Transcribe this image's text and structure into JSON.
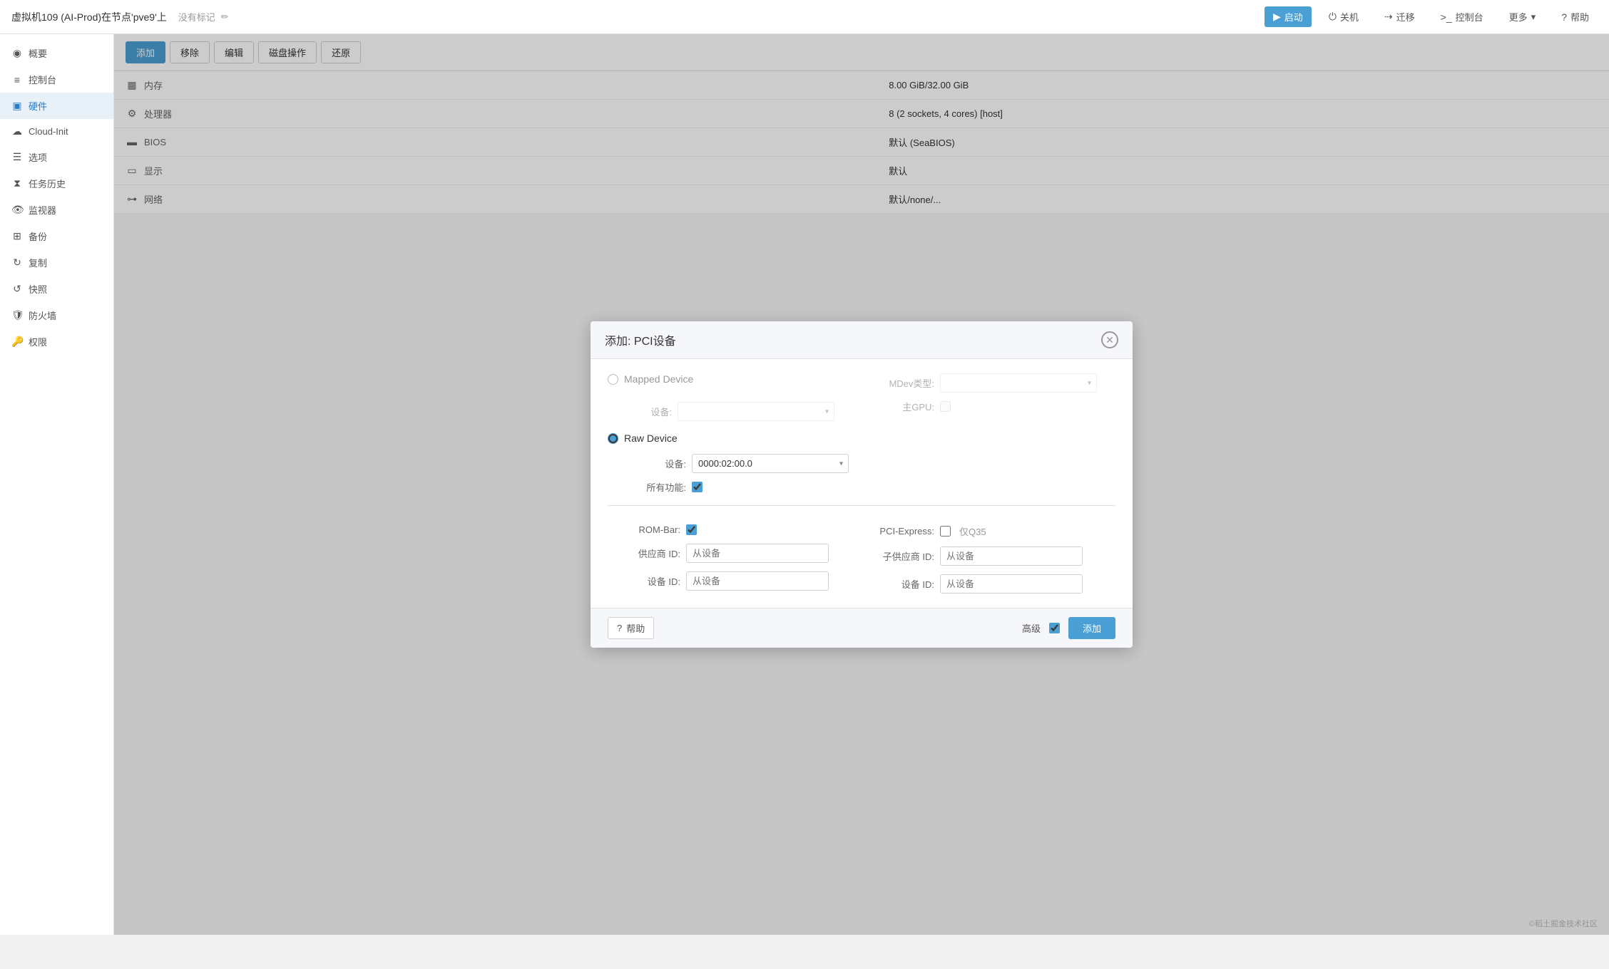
{
  "topbar": {
    "vm_title": "虚拟机109 (AI-Prod)在节点'pve9'上",
    "tag_placeholder": "没有标记",
    "btn_start": "启动",
    "btn_shutdown": "关机",
    "btn_migrate": "迁移",
    "btn_console": "控制台",
    "btn_more": "更多",
    "btn_help": "帮助"
  },
  "sidebar": {
    "items": [
      {
        "id": "summary",
        "label": "概要",
        "icon": "◉"
      },
      {
        "id": "console",
        "label": "控制台",
        "icon": "≡"
      },
      {
        "id": "hardware",
        "label": "硬件",
        "icon": "▣",
        "active": true
      },
      {
        "id": "cloudinit",
        "label": "Cloud-Init",
        "icon": "☁"
      },
      {
        "id": "options",
        "label": "选项",
        "icon": "☰"
      },
      {
        "id": "taskhistory",
        "label": "任务历史",
        "icon": "⧗"
      },
      {
        "id": "monitor",
        "label": "监视器",
        "icon": "👁"
      },
      {
        "id": "backup",
        "label": "备份",
        "icon": "⊞"
      },
      {
        "id": "replication",
        "label": "复制",
        "icon": "↻"
      },
      {
        "id": "snapshot",
        "label": "快照",
        "icon": "↺"
      },
      {
        "id": "firewall",
        "label": "防火墙",
        "icon": "🛡"
      },
      {
        "id": "permissions",
        "label": "权限",
        "icon": "🔑"
      }
    ]
  },
  "toolbar": {
    "btn_add": "添加",
    "btn_remove": "移除",
    "btn_edit": "编辑",
    "btn_disk_ops": "磁盘操作",
    "btn_restore": "还原"
  },
  "hardware_table": {
    "rows": [
      {
        "icon": "mem",
        "label": "内存",
        "value": "8.00 GiB/32.00 GiB"
      },
      {
        "icon": "cpu",
        "label": "处理器",
        "value": "8 (2 sockets, 4 cores) [host]"
      },
      {
        "icon": "bios",
        "label": "BIOS",
        "value": "默认 (SeaBIOS)"
      },
      {
        "icon": "display",
        "label": "显示",
        "value": "默认"
      },
      {
        "icon": "net",
        "label": "网络",
        "value": "默认/none/..."
      }
    ]
  },
  "dialog": {
    "title": "添加: PCI设备",
    "mapped_device_label": "Mapped Device",
    "raw_device_label": "Raw Device",
    "mdev_type_label": "MDev类型:",
    "primary_gpu_label": "主GPU:",
    "device_label": "设备:",
    "all_functions_label": "所有功能:",
    "device_value": "0000:02:00.0",
    "rom_bar_label": "ROM-Bar:",
    "pci_express_label": "PCI-Express:",
    "only_q35_label": "仅Q35",
    "vendor_id_label": "供应商 ID:",
    "sub_vendor_id_label": "子供应商 ID:",
    "device_id_label": "设备 ID:",
    "sub_device_id_label": "设备 ID:",
    "from_device_placeholder": "从设备",
    "advanced_label": "高级",
    "btn_help": "帮助",
    "btn_add": "添加",
    "mapped_device_selected": false,
    "raw_device_selected": true,
    "rom_bar_checked": true,
    "all_functions_checked": true,
    "primary_gpu_checked": false,
    "pci_express_checked": false,
    "only_q35_checked": false,
    "advanced_checked": true
  },
  "watermark": "©稻土掘金技术社区"
}
